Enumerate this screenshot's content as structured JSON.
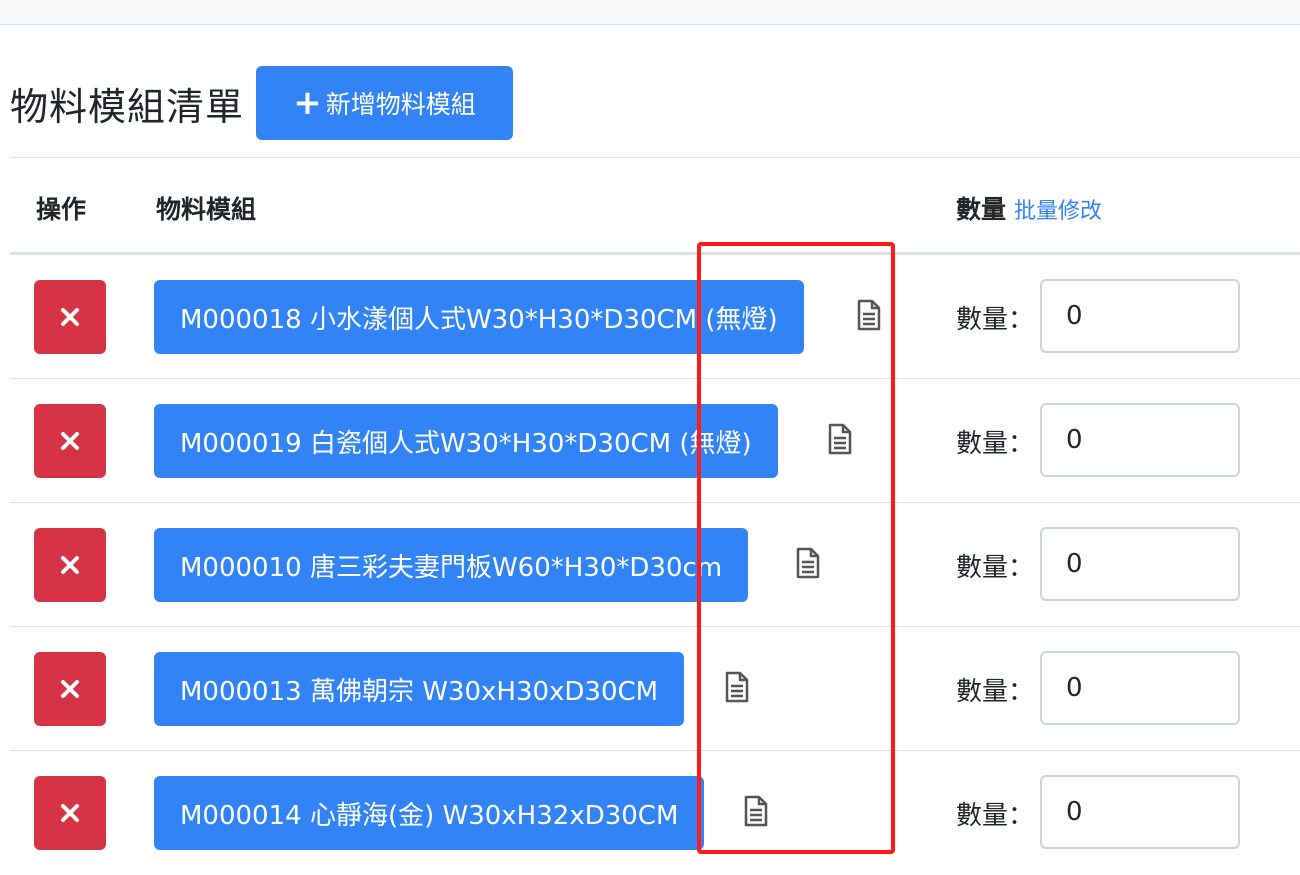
{
  "header": {
    "title": "物料模組清單",
    "add_button": {
      "plus": "+",
      "label": "新增物料模組"
    }
  },
  "table": {
    "columns": {
      "action": "操作",
      "module": "物料模組",
      "quantity": "數量",
      "batch_edit": "批量修改"
    },
    "qty_label": "數量：",
    "rows": [
      {
        "name": "M000018 小水漾個人式W30*H30*D30CM (無燈)",
        "qty": "0"
      },
      {
        "name": "M000019 白瓷個人式W30*H30*D30CM (無燈)",
        "qty": "0"
      },
      {
        "name": "M000010 唐三彩夫妻門板W60*H30*D30cm",
        "qty": "0"
      },
      {
        "name": "M000013 萬佛朝宗 W30xH30xD30CM",
        "qty": "0"
      },
      {
        "name": "M000014 心靜海(金) W30xH32xD30CM",
        "qty": "0"
      }
    ]
  },
  "colors": {
    "primary": "#3183f6",
    "danger": "#d63345",
    "highlight": "#ff1a1a"
  },
  "icons": {
    "delete": "close-icon",
    "detail": "document-icon",
    "add": "plus-icon"
  }
}
